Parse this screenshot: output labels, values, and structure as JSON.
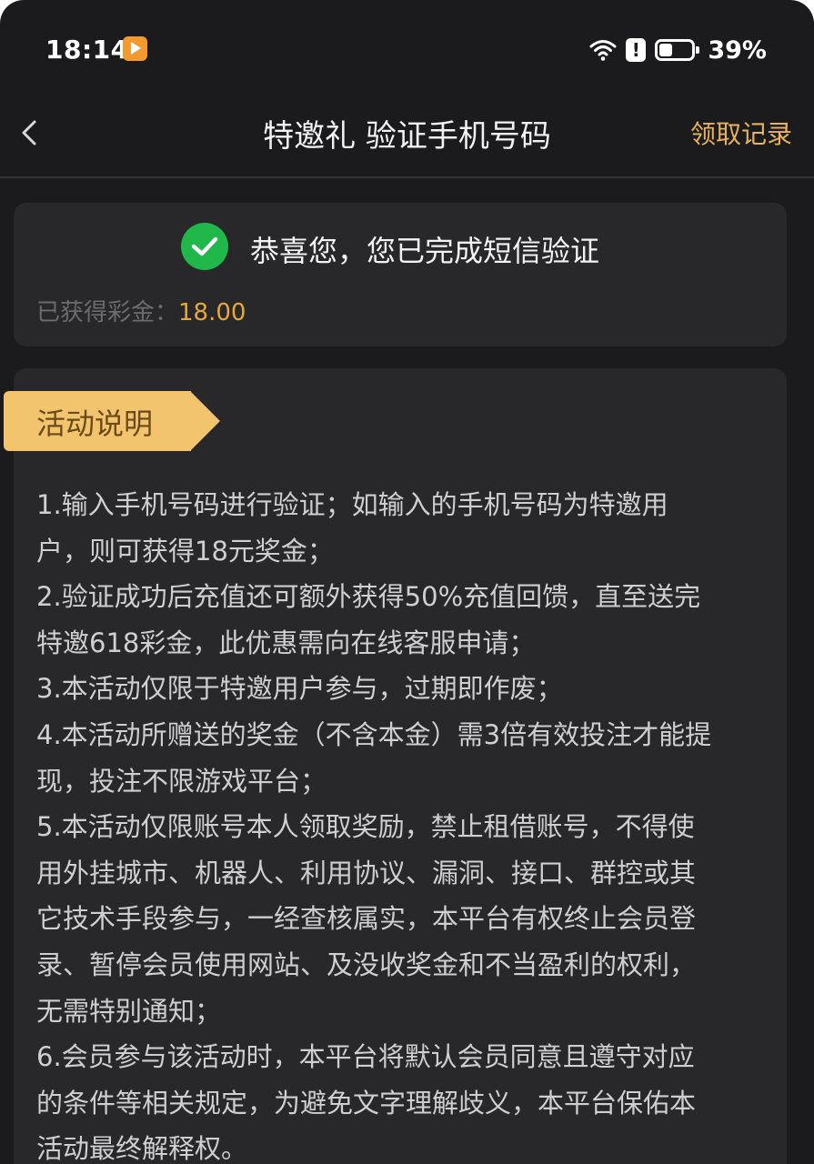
{
  "status_bar": {
    "time": "18:14",
    "battery_percent": "39%",
    "battery_level": 0.39,
    "icons": [
      "app-notification-icon",
      "wifi-icon",
      "alert-icon",
      "battery-icon"
    ]
  },
  "nav": {
    "title": "特邀礼 验证手机号码",
    "action_label": "领取记录",
    "back_icon": "chevron-left-icon"
  },
  "success": {
    "icon": "check-circle-icon",
    "message": "恭喜您，您已完成短信验证",
    "bonus_label": "已获得彩金：",
    "bonus_value": "18.00"
  },
  "activity": {
    "section_title": "活动说明",
    "lines": [
      "1.输入手机号码进行验证；如输入的手机号码为特邀用",
      "户，则可获得18元奖金；",
      "2.验证成功后充值还可额外获得50%充值回馈，直至送完",
      "特邀618彩金，此优惠需向在线客服申请；",
      "3.本活动仅限于特邀用户参与，过期即作废；",
      "4.本活动所赠送的奖金（不含本金）需3倍有效投注才能提",
      "现，投注不限游戏平台；",
      "5.本活动仅限账号本人领取奖励，禁止租借账号，不得使",
      "用外挂城市、机器人、利用协议、漏洞、接口、群控或其",
      "它技术手段参与，一经查核属实，本平台有权终止会员登",
      "录、暂停会员使用网站、及没收奖金和不当盈利的权利，",
      "无需特别通知；",
      "6.会员参与该活动时，本平台将默认会员同意且遵守对应",
      "的条件等相关规定，为避免文字理解歧义，本平台保佑本",
      "活动最终解释权。"
    ]
  },
  "colors": {
    "background": "#1b1b1d",
    "card": "#28282a",
    "accent_gold": "#e8b35c",
    "bonus_orange": "#e8a73c",
    "success_green": "#20b84a",
    "ribbon": "#f2c46e"
  }
}
